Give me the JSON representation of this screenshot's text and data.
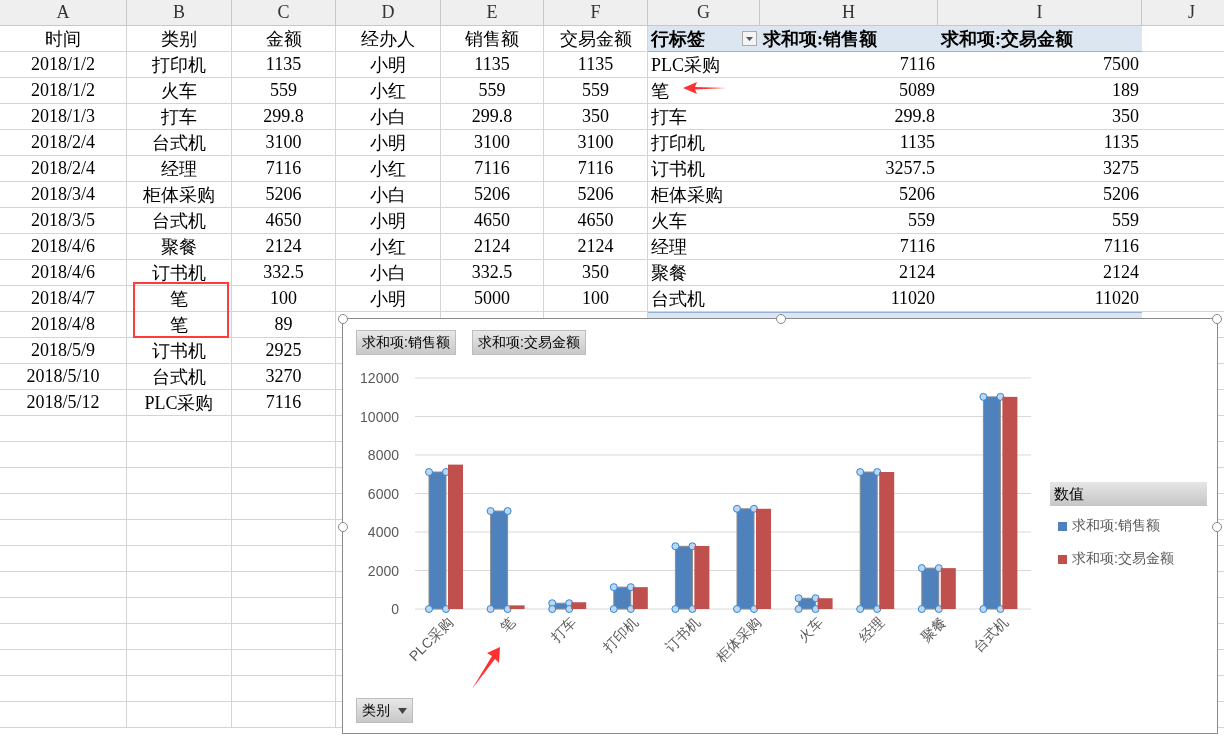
{
  "sheet": {
    "column_headers": [
      "A",
      "B",
      "C",
      "D",
      "E",
      "F",
      "G",
      "H",
      "I",
      "J"
    ],
    "header_row": [
      "时间",
      "类别",
      "金额",
      "经办人",
      "销售额",
      "交易金额"
    ],
    "rows": [
      [
        "2018/1/2",
        "打印机",
        "1135",
        "小明",
        "1135",
        "1135"
      ],
      [
        "2018/1/2",
        "火车",
        "559",
        "小红",
        "559",
        "559"
      ],
      [
        "2018/1/3",
        "打车",
        "299.8",
        "小白",
        "299.8",
        "350"
      ],
      [
        "2018/2/4",
        "台式机",
        "3100",
        "小明",
        "3100",
        "3100"
      ],
      [
        "2018/2/4",
        "经理",
        "7116",
        "小红",
        "7116",
        "7116"
      ],
      [
        "2018/3/4",
        "柜体采购",
        "5206",
        "小白",
        "5206",
        "5206"
      ],
      [
        "2018/3/5",
        "台式机",
        "4650",
        "小明",
        "4650",
        "4650"
      ],
      [
        "2018/4/6",
        "聚餐",
        "2124",
        "小红",
        "2124",
        "2124"
      ],
      [
        "2018/4/6",
        "订书机",
        "332.5",
        "小白",
        "332.5",
        "350"
      ],
      [
        "2018/4/7",
        "笔",
        "100",
        "小明",
        "5000",
        "100"
      ],
      [
        "2018/4/8",
        "笔",
        "89"
      ],
      [
        "2018/5/9",
        "订书机",
        "2925"
      ],
      [
        "2018/5/10",
        "台式机",
        "3270"
      ],
      [
        "2018/5/12",
        "PLC采购",
        "7116"
      ]
    ]
  },
  "pivot": {
    "row_label": "行标签",
    "columns": [
      "求和项:销售额",
      "求和项:交易金额"
    ],
    "rows": [
      {
        "label": "PLC采购",
        "values": [
          "7116",
          "7500"
        ]
      },
      {
        "label": "笔",
        "values": [
          "5089",
          "189"
        ]
      },
      {
        "label": "打车",
        "values": [
          "299.8",
          "350"
        ]
      },
      {
        "label": "打印机",
        "values": [
          "1135",
          "1135"
        ]
      },
      {
        "label": "订书机",
        "values": [
          "3257.5",
          "3275"
        ]
      },
      {
        "label": "柜体采购",
        "values": [
          "5206",
          "5206"
        ]
      },
      {
        "label": "火车",
        "values": [
          "559",
          "559"
        ]
      },
      {
        "label": "经理",
        "values": [
          "7116",
          "7116"
        ]
      },
      {
        "label": "聚餐",
        "values": [
          "2124",
          "2124"
        ]
      },
      {
        "label": "台式机",
        "values": [
          "11020",
          "11020"
        ]
      }
    ]
  },
  "chart": {
    "field_buttons": [
      "求和项:销售额",
      "求和项:交易金额"
    ],
    "axis_field_button": "类别",
    "legend_title": "数值",
    "chart_data": {
      "type": "bar",
      "categories": [
        "PLC采购",
        "笔",
        "打车",
        "打印机",
        "订书机",
        "柜体采购",
        "火车",
        "经理",
        "聚餐",
        "台式机"
      ],
      "series": [
        {
          "name": "求和项:销售额",
          "color": "#4f81bd",
          "values": [
            7116,
            5089,
            299.8,
            1135,
            3257.5,
            5206,
            559,
            7116,
            2124,
            11020
          ]
        },
        {
          "name": "求和项:交易金额",
          "color": "#c0504d",
          "values": [
            7500,
            189,
            350,
            1135,
            3275,
            5206,
            559,
            7116,
            2124,
            11020
          ]
        }
      ],
      "grid": true,
      "ylim": [
        0,
        12000
      ],
      "yticks": [
        0,
        2000,
        4000,
        6000,
        8000,
        10000,
        12000
      ]
    }
  }
}
